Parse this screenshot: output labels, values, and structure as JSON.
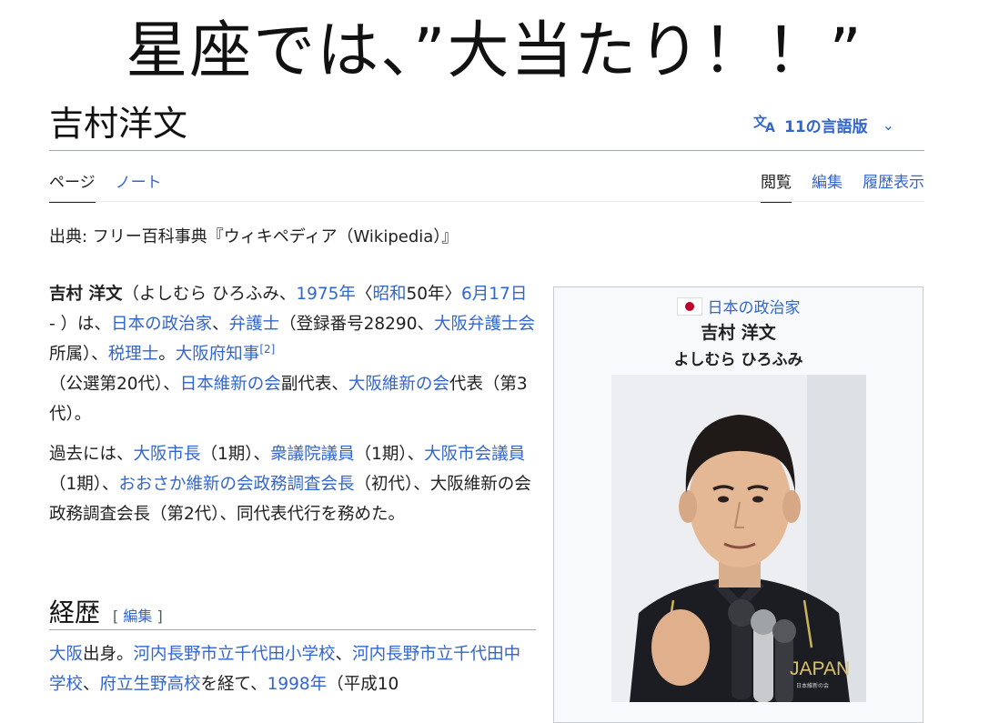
{
  "caption": "星座では、”大当たり！！”",
  "article": {
    "title": "吉村洋文",
    "languages_label": "11の言語版"
  },
  "tabs": {
    "page": "ページ",
    "talk": "ノート",
    "read": "閲覧",
    "edit": "編集",
    "history": "履歴表示"
  },
  "source_line": "出典: フリー百科事典『ウィキペディア（Wikipedia）』",
  "p1": {
    "name": "吉村 洋文",
    "t1": "（よしむら ひろふみ、",
    "l1": "1975年",
    "t2": "〈",
    "l2": "昭和",
    "t3": "50年〉",
    "l3": "6月17日",
    "t4": " - ）は、",
    "l4": "日本の政治家",
    "t5": "、",
    "l5": "弁護士",
    "t6": "（登録番号28290、",
    "l6": "大阪弁護士会",
    "t7": "所属）、",
    "l7": "税理士",
    "t8": "。",
    "l8": "大阪府知事",
    "ref": "[2]",
    "t9": "（公選第20代）、",
    "l9": "日本維新の会",
    "t10": "副代表、",
    "l10": "大阪維新の会",
    "t11": "代表（第3代）。"
  },
  "p2": {
    "t1": "過去には、",
    "l1": "大阪市長",
    "t2": "（1期）、",
    "l2": "衆議院議員",
    "t3": "（1期）、",
    "l3": "大阪市会議員",
    "t4": "（1期）、",
    "l4": "おおさか維新の会政務調査会長",
    "t5": "（初代）、大阪維新の会政務調査会長（第2代）、同代表代行を務めた。"
  },
  "section": {
    "heading": "経歴",
    "edit_open": "[ ",
    "edit_label": "編集",
    "edit_close": " ]"
  },
  "p3": {
    "l1": "大阪",
    "t1": "出身。",
    "l2": "河内長野市立千代田小学校",
    "t2": "、",
    "l3": "河内長野市立千代田中学校",
    "t3": "、",
    "l4": "府立生野高校",
    "t4": "を経て、",
    "l5": "1998年",
    "t5": "（平成10"
  },
  "infobox": {
    "category": "日本の政治家",
    "name": "吉村 洋文",
    "reading": "よしむら ひろふみ",
    "shirt_text": "JAPAN",
    "shirt_subtext": "日本維新の会"
  },
  "colors": {
    "link": "#3366cc",
    "text": "#202122",
    "flag_red": "#bc002d"
  }
}
